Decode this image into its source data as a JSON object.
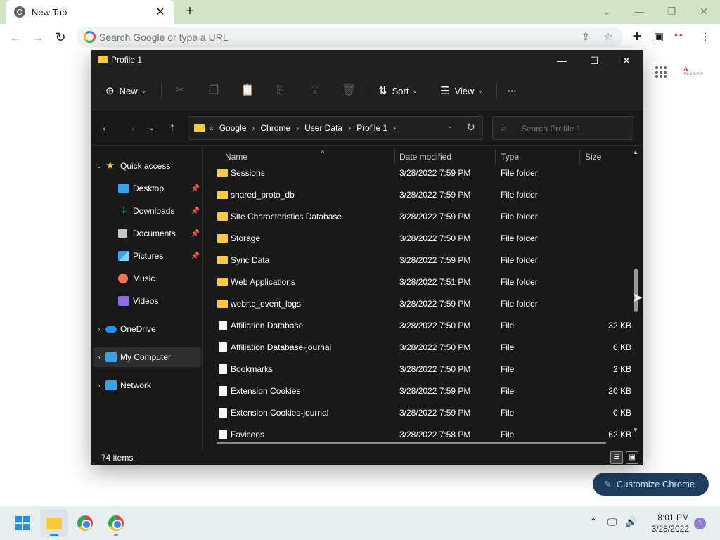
{
  "browser": {
    "tab_title": "New Tab",
    "tab_close": "✕",
    "new_tab": "+",
    "window_controls": {
      "collapse": "⌄",
      "minimize": "—",
      "restore": "❐",
      "close": "✕"
    },
    "nav": {
      "back": "←",
      "forward": "→",
      "reload": "↻"
    },
    "omnibox_placeholder": "Search Google or type a URL",
    "toolbar_icons": [
      "share-icon",
      "star-icon",
      "extensions-icon",
      "sidebar-icon",
      "profile-icon",
      "menu-icon"
    ]
  },
  "ntp": {
    "avatar_text": "ASCENSION",
    "customize_label": "Customize Chrome"
  },
  "explorer": {
    "title": "Profile 1",
    "window_controls": {
      "minimize": "—",
      "maximize": "☐",
      "close": "✕"
    },
    "commands": {
      "new": "New",
      "sort": "Sort",
      "view": "View",
      "more": "···"
    },
    "breadcrumb": [
      "Google",
      "Chrome",
      "User Data",
      "Profile 1"
    ],
    "breadcrumb_overflow": "«",
    "search_placeholder": "Search Profile 1",
    "nav_pane": [
      {
        "label": "Quick access",
        "icon": "star-icon",
        "color": "#f8c93c"
      },
      {
        "label": "Desktop",
        "icon": "desktop-icon",
        "color": "#3aa0e8",
        "pinned": true
      },
      {
        "label": "Downloads",
        "icon": "download-icon",
        "color": "#2fa86a",
        "pinned": true
      },
      {
        "label": "Documents",
        "icon": "documents-icon",
        "color": "#c7c7c7",
        "pinned": true
      },
      {
        "label": "Pictures",
        "icon": "pictures-icon",
        "color": "#3aa0e8",
        "pinned": true
      },
      {
        "label": "Music",
        "icon": "music-icon",
        "color": "#e8735a"
      },
      {
        "label": "Videos",
        "icon": "videos-icon",
        "color": "#8d6be0"
      },
      {
        "label": "OneDrive",
        "icon": "cloud-icon",
        "color": "#2b8de6"
      },
      {
        "label": "My Computer",
        "icon": "computer-icon",
        "color": "#3aa0e8"
      },
      {
        "label": "Network",
        "icon": "network-icon",
        "color": "#3aa0e8"
      }
    ],
    "columns": {
      "name": "Name",
      "date": "Date modified",
      "type": "Type",
      "size": "Size"
    },
    "files": [
      {
        "name": "Sessions",
        "date": "3/28/2022 7:59 PM",
        "type": "File folder",
        "size": "",
        "kind": "folder"
      },
      {
        "name": "shared_proto_db",
        "date": "3/28/2022 7:59 PM",
        "type": "File folder",
        "size": "",
        "kind": "folder"
      },
      {
        "name": "Site Characteristics Database",
        "date": "3/28/2022 7:59 PM",
        "type": "File folder",
        "size": "",
        "kind": "folder"
      },
      {
        "name": "Storage",
        "date": "3/28/2022 7:50 PM",
        "type": "File folder",
        "size": "",
        "kind": "folder"
      },
      {
        "name": "Sync Data",
        "date": "3/28/2022 7:59 PM",
        "type": "File folder",
        "size": "",
        "kind": "folder"
      },
      {
        "name": "Web Applications",
        "date": "3/28/2022 7:51 PM",
        "type": "File folder",
        "size": "",
        "kind": "folder"
      },
      {
        "name": "webrtc_event_logs",
        "date": "3/28/2022 7:59 PM",
        "type": "File folder",
        "size": "",
        "kind": "folder"
      },
      {
        "name": "Affiliation Database",
        "date": "3/28/2022 7:50 PM",
        "type": "File",
        "size": "32 KB",
        "kind": "file"
      },
      {
        "name": "Affiliation Database-journal",
        "date": "3/28/2022 7:50 PM",
        "type": "File",
        "size": "0 KB",
        "kind": "file"
      },
      {
        "name": "Bookmarks",
        "date": "3/28/2022 7:50 PM",
        "type": "File",
        "size": "2 KB",
        "kind": "file"
      },
      {
        "name": "Extension Cookies",
        "date": "3/28/2022 7:59 PM",
        "type": "File",
        "size": "20 KB",
        "kind": "file"
      },
      {
        "name": "Extension Cookies-journal",
        "date": "3/28/2022 7:59 PM",
        "type": "File",
        "size": "0 KB",
        "kind": "file"
      },
      {
        "name": "Favicons",
        "date": "3/28/2022 7:58 PM",
        "type": "File",
        "size": "62 KB",
        "kind": "file"
      }
    ],
    "item_count": "74 items"
  },
  "taskbar": {
    "time": "8:01 PM",
    "date": "3/28/2022",
    "notifications": "1"
  }
}
